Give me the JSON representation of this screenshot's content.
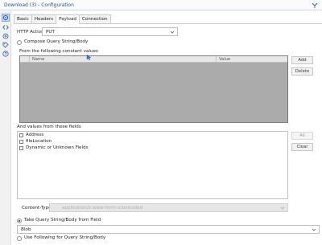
{
  "window": {
    "title": "Download (3) - Configuration"
  },
  "tabs": [
    {
      "label": "Basic"
    },
    {
      "label": "Headers"
    },
    {
      "label": "Payload"
    },
    {
      "label": "Connection"
    }
  ],
  "http_action": {
    "label": "HTTP Action",
    "value": "PUT"
  },
  "compose": {
    "label": "Compose Query String/Body"
  },
  "constants": {
    "heading": "From the following constant values",
    "columns": [
      "Name",
      "Value"
    ],
    "add_label": "Add",
    "delete_label": "Delete"
  },
  "fields": {
    "heading": "And values from these fields",
    "items": [
      {
        "label": "Address"
      },
      {
        "label": "fileLocation"
      },
      {
        "label": "Dynamic or Unknown Fields"
      }
    ],
    "all_label": "All",
    "clear_label": "Clear"
  },
  "content_type": {
    "label": "Content-Type",
    "value": "application/x-www-form-urlencoded"
  },
  "take_query": {
    "label": "Take Query String/Body from Field",
    "selected": true
  },
  "blob_field": {
    "value": "Blob"
  },
  "use_following": {
    "label": "Use Following for Query String/Body"
  },
  "colors": {
    "title": "#1f4f95",
    "selected_tab": "#ffffff",
    "grid_fill": "#ababab"
  }
}
